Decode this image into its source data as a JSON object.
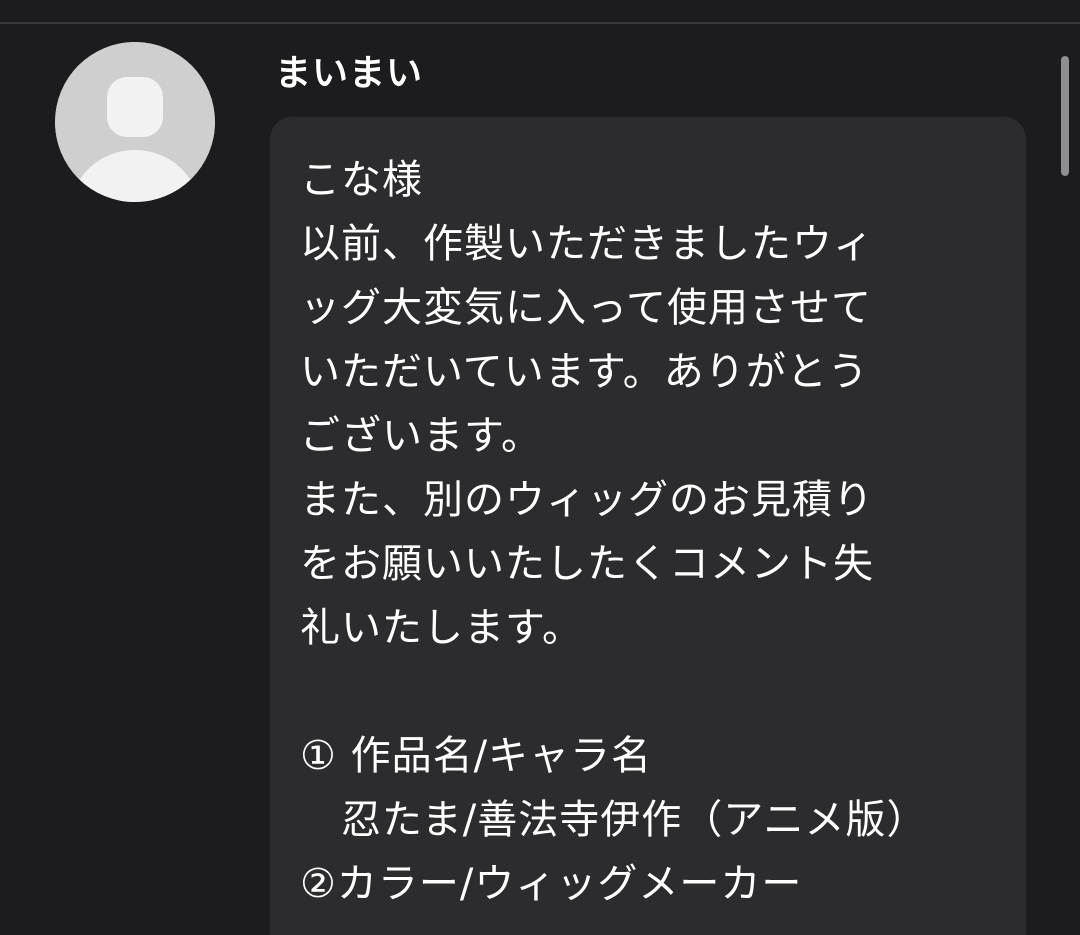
{
  "comment": {
    "username": "まいまい",
    "avatar_icon": "default-user-avatar-icon",
    "message_lines": [
      "こな様",
      "以前、作製いただきましたウィ",
      "ッグ大変気に入って使用させて",
      "いただいています。ありがとう",
      "ございます。",
      "また、別のウィッグのお見積り",
      "をお願いいたしたくコメント失",
      "礼いたします。",
      "",
      "① 作品名/キャラ名",
      "　忍たま/善法寺伊作（アニメ版）",
      "②カラー/ウィッグメーカー"
    ]
  },
  "colors": {
    "background": "#1c1c1e",
    "bubble": "#2c2c2e",
    "text": "#ffffff",
    "avatar": "#cfcfcf",
    "scrollbar": "#8e8e93"
  }
}
